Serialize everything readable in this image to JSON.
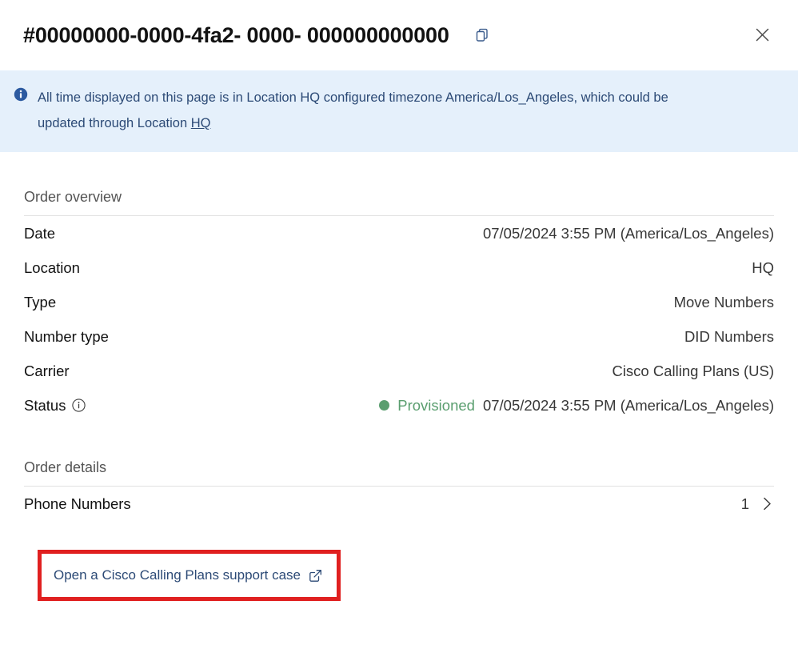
{
  "header": {
    "order_id": "#00000000-0000-4fa2- 0000- 000000000000",
    "copy_icon": "copy-icon",
    "close_icon": "close-icon"
  },
  "banner": {
    "icon": "info-filled-icon",
    "text": "All time displayed on this page is in Location HQ configured timezone America/Los_Angeles, which could be updated through Location ",
    "link_text": "HQ",
    "bg_color": "#e5f0fb",
    "text_color": "#2c4a76"
  },
  "order_overview": {
    "title": "Order overview",
    "rows": [
      {
        "label": "Date",
        "value": "07/05/2024 3:55 PM (America/Los_Angeles)"
      },
      {
        "label": "Location",
        "value": "HQ"
      },
      {
        "label": "Type",
        "value": "Move Numbers"
      },
      {
        "label": "Number type",
        "value": "DID Numbers"
      },
      {
        "label": "Carrier",
        "value": "Cisco Calling Plans (US)"
      }
    ],
    "status_row": {
      "label": "Status",
      "info_icon": "info-outline-icon",
      "state": "Provisioned",
      "state_color": "#5a9e6f",
      "timestamp": "07/05/2024 3:55 PM (America/Los_Angeles)"
    }
  },
  "order_details": {
    "title": "Order details",
    "rows": [
      {
        "label": "Phone Numbers",
        "value": "1",
        "chevron": "chevron-right-icon"
      }
    ]
  },
  "support": {
    "link_text": "Open a Cisco Calling Plans support case",
    "external_icon": "external-link-icon",
    "highlight_color": "#e02020",
    "link_color": "#2c4a76"
  }
}
